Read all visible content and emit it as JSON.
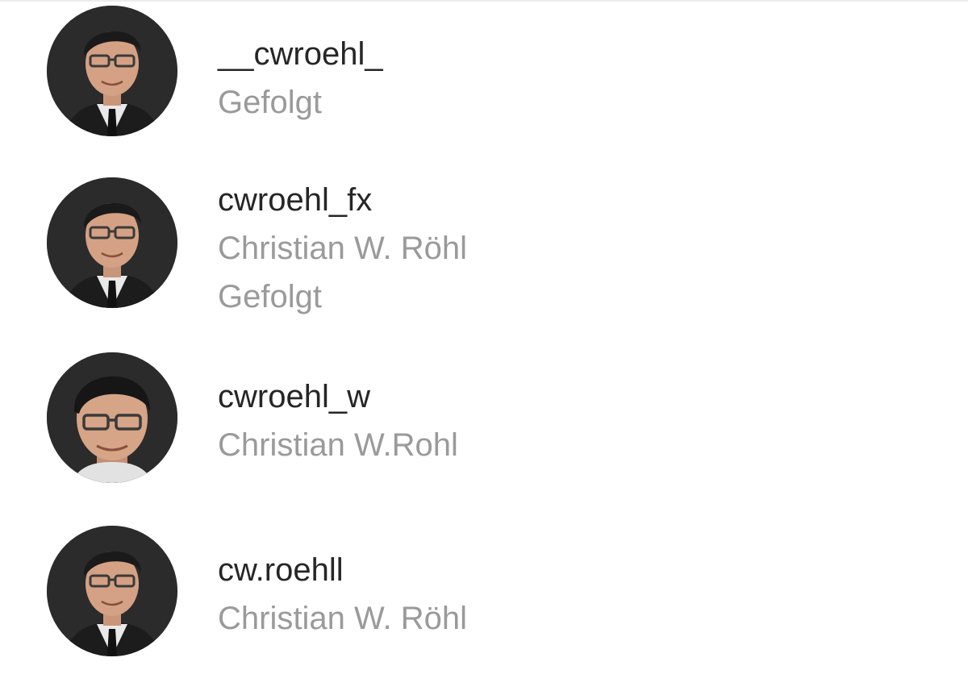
{
  "results": [
    {
      "username": "__cwroehl_",
      "full_name": "",
      "status": "Gefolgt"
    },
    {
      "username": "cwroehl_fx",
      "full_name": "Christian W. Röhl",
      "status": "Gefolgt"
    },
    {
      "username": "cwroehl_w",
      "full_name": "Christian W.Rohl",
      "status": ""
    },
    {
      "username": "cw.roehll",
      "full_name": "Christian W. Röhl",
      "status": ""
    }
  ]
}
